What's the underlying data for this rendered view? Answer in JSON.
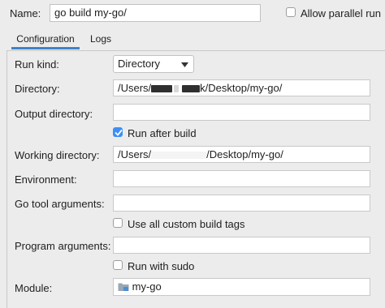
{
  "header": {
    "name_label": "Name:",
    "name_value": "go build my-go/",
    "allow_parallel_label": "Allow parallel run"
  },
  "tabs": [
    {
      "label": "Configuration",
      "active": true
    },
    {
      "label": "Logs",
      "active": false
    }
  ],
  "form": {
    "run_kind": {
      "label": "Run kind:",
      "value": "Directory"
    },
    "directory": {
      "label": "Directory:",
      "value_prefix": "/Users/",
      "value_suffix": "k/Desktop/my-go/"
    },
    "output_directory": {
      "label": "Output directory:",
      "value": ""
    },
    "run_after_build": {
      "label": "Run after build",
      "checked": true
    },
    "working_directory": {
      "label": "Working directory:",
      "value_prefix": "/Users/",
      "value_suffix": "/Desktop/my-go/"
    },
    "environment": {
      "label": "Environment:",
      "value": ""
    },
    "go_tool_arguments": {
      "label": "Go tool arguments:",
      "value": ""
    },
    "use_all_custom_build_tags": {
      "label": "Use all custom build tags",
      "checked": false
    },
    "program_arguments": {
      "label": "Program arguments:",
      "value": ""
    },
    "run_with_sudo": {
      "label": "Run with sudo",
      "checked": false
    },
    "module": {
      "label": "Module:",
      "value": "my-go",
      "icon": "module-folder-icon"
    }
  },
  "colors": {
    "background": "#ececec",
    "accent": "#3e8ef7",
    "tab_underline": "#4083c9"
  }
}
